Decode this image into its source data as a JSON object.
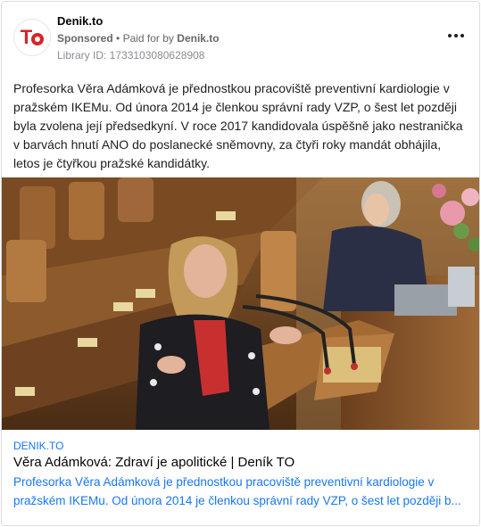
{
  "advertiser": {
    "name": "Denik.to",
    "logo_letters": "TO",
    "sponsored": "Sponsored",
    "separator": "•",
    "paid_for_by": "Paid for by",
    "payer": "Denik.to",
    "library_id": "Library ID: 1733103080628908"
  },
  "post": {
    "text": "Profesorka Věra Adámková je přednostkou pracoviště preventivní kardiologie v pražském IKEMu. Od února 2014 je členkou správní rady VZP, o šest let později byla zvolena její předsedkyní. V roce 2017 kandidovala úspěšně jako nestranička v barvách hnutí ANO do poslanecké sněmovny, za čtyři roky mandát obhájila, letos je čtyřkou pražské kandidátky."
  },
  "link_preview": {
    "domain": "DENIK.TO",
    "headline": "Věra Adámková: Zdraví je apolitické | Deník TO",
    "description_line1": "Profesorka Věra Adámková je přednostkou pracoviště preventivní kardiologie v",
    "description_line2": "pražském IKEMu. Od února 2014 je členkou správní rady VZP, o šest let později b..."
  },
  "colors": {
    "brand_red": "#d8232a",
    "link_blue": "#1877f2"
  },
  "icons": {
    "more": "more-horizontal-icon",
    "logo": "denik-to-logo"
  }
}
